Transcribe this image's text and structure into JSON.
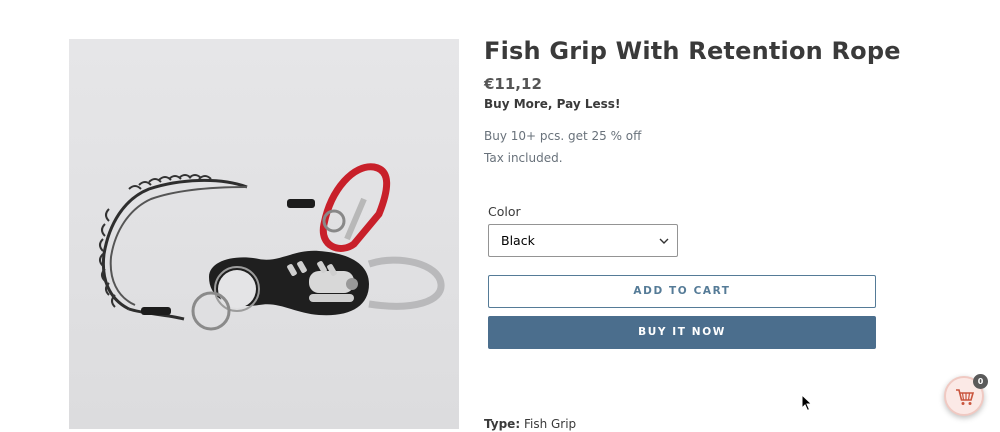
{
  "product": {
    "title": "Fish Grip With Retention Rope",
    "price": "€11,12",
    "promo": "Buy More, Pay Less!",
    "bulk_offer": "Buy 10+ pcs. get 25 % off",
    "tax_note": "Tax included.",
    "image_icon": "product-photo"
  },
  "options": {
    "color_label": "Color",
    "color_selected": "Black"
  },
  "actions": {
    "add_to_cart": "ADD TO CART",
    "buy_now": "BUY IT NOW"
  },
  "details": {
    "type_label": "Type:",
    "type_value": "Fish Grip"
  },
  "cart_widget": {
    "icon": "shopping-cart-icon",
    "count": "0"
  },
  "colors": {
    "accent": "#557b97",
    "buy_button": "#4b6e8d",
    "carabiner": "#c8202a"
  }
}
